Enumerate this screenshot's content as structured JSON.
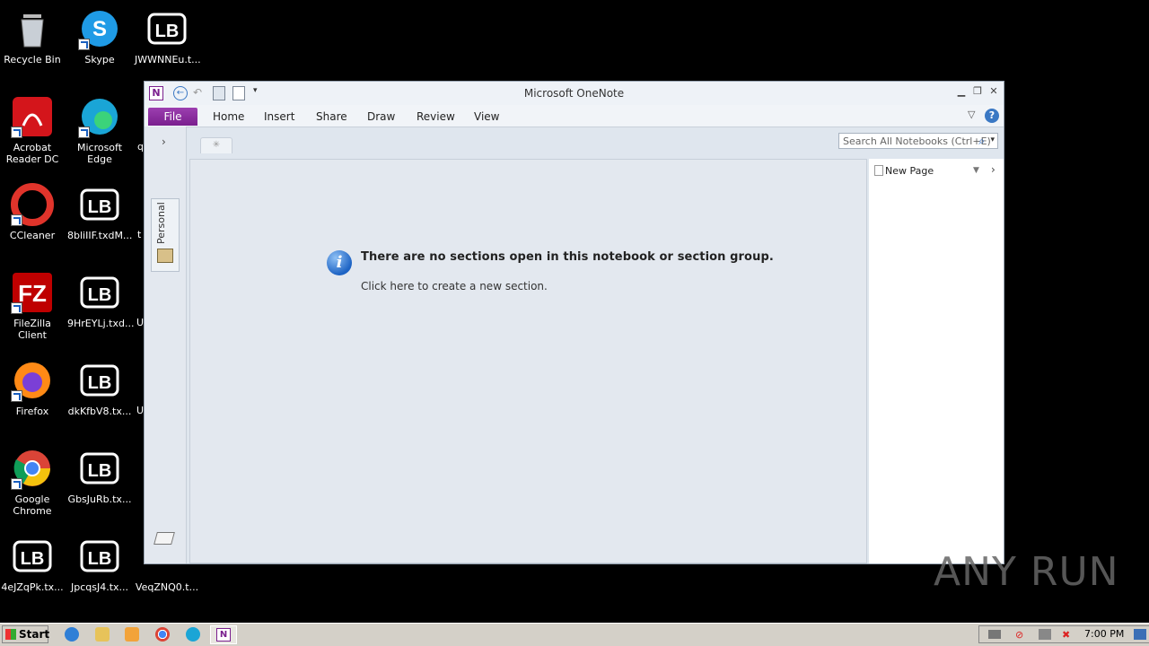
{
  "desktop": {
    "icons": [
      {
        "label": "Recycle Bin"
      },
      {
        "label": "Skype"
      },
      {
        "label": "JWWNNEu.t..."
      },
      {
        "label": "Acrobat Reader DC"
      },
      {
        "label": "Microsoft Edge"
      },
      {
        "label": "CCleaner"
      },
      {
        "label": "8bliIIF.txdM..."
      },
      {
        "label": "FileZilla Client"
      },
      {
        "label": "9HrEYLj.txd..."
      },
      {
        "label": "Firefox"
      },
      {
        "label": "dkKfbV8.tx..."
      },
      {
        "label": "Google Chrome"
      },
      {
        "label": "GbsJuRb.tx..."
      },
      {
        "label": "4eJZqPk.tx..."
      },
      {
        "label": "JpcqsJ4.tx..."
      },
      {
        "label": "VeqZNQ0.t..."
      }
    ],
    "partial_labels": [
      "q",
      "t",
      "U",
      "U"
    ]
  },
  "window": {
    "title": "Microsoft OneNote",
    "tabs": [
      "File",
      "Home",
      "Insert",
      "Share",
      "Draw",
      "Review",
      "View"
    ],
    "search_placeholder": "Search All Notebooks (Ctrl+E)",
    "notebook_name": "Personal",
    "new_page_label": "New Page",
    "message_title": "There are no sections open in this notebook or section group.",
    "message_link": "Click here to create a new section."
  },
  "taskbar": {
    "start_label": "Start",
    "clock": "7:00 PM"
  },
  "watermark": "ANY RUN"
}
